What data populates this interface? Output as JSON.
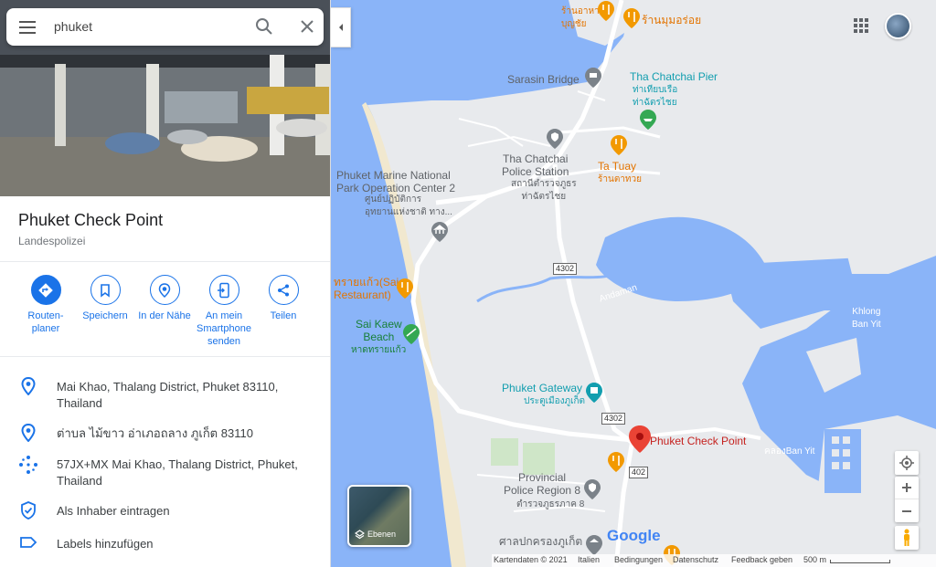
{
  "search": {
    "value": "phuket"
  },
  "place": {
    "title": "Phuket Check Point",
    "category": "Landespolizei"
  },
  "actions": [
    {
      "label": "Routen-\nplaner",
      "icon": "directions-icon"
    },
    {
      "label": "Speichern",
      "icon": "bookmark-icon"
    },
    {
      "label": "In der Nähe",
      "icon": "nearby-icon"
    },
    {
      "label": "An mein Smartphone senden",
      "icon": "send-to-phone-icon"
    },
    {
      "label": "Teilen",
      "icon": "share-icon"
    }
  ],
  "details": {
    "address": "Mai Khao, Thalang District, Phuket 83110, Thailand",
    "address_thai": "ต่าบล ไม้ขาว อ่าเภอถลาง ภูเก็ต 83110",
    "plus_code": "57JX+MX Mai Khao, Thalang District, Phuket, Thailand",
    "claim": "Als Inhaber eintragen",
    "labels": "Labels hinzufügen"
  },
  "map_labels": {
    "sarasin": "Sarasin Bridge",
    "pier": "Tha Chatchai Pier",
    "pier_thai": "ท่าเทียบเรือ\nท่าฉัตรไชย",
    "police_station": "Tha Chatchai\nPolice Station",
    "police_station_thai": "สถานีตำรวจภูธร\nท่าฉัตรไชย",
    "ta_tuay": "Ta Tuay",
    "ta_tuay_thai": "ร้านตาทวย",
    "marine": "Phuket Marine National\nPark Operation Center 2",
    "marine_thai": "ศูนย์ปฏิบัติการ\nอุทยานแห่งชาติ ทาง...",
    "sai_rest": "ทรายแก้ว(Sai\nRestaurant)",
    "sai_kaew": "Sai Kaew\nBeach",
    "sai_kaew_thai": "หาดทรายแก้ว",
    "andaman": "Andaman",
    "khlong": "Khlong\nBan Yit",
    "gateway": "Phuket Gateway",
    "gateway_thai": "ประตูเมืองภูเก็ต",
    "checkpoint": "Phuket Check Point",
    "ban_yit": "คลองBan Yit",
    "provincial": "Provincial\nPolice Region 8",
    "provincial_thai": "ตำรวจภูธรภาค 8",
    "court": "ศาลปกครองภูเก็ต",
    "top_thai1": "ร้านอาหาร",
    "top_thai2": "บุญชัย",
    "top_rest": "ร้านมุมอร่อย",
    "road_4302a": "4302",
    "road_4302b": "4302",
    "road_402": "402",
    "google": "Google"
  },
  "layers": {
    "label": "Ebenen"
  },
  "footer": {
    "mapdata": "Kartendaten © 2021",
    "region": "Italien",
    "terms": "Bedingungen",
    "privacy": "Datenschutz",
    "feedback": "Feedback geben",
    "scale": "500 m"
  },
  "colors": {
    "water": "#8ab4f8",
    "land": "#e8eaed",
    "accent": "#1a73e8",
    "pin": "#ea4335",
    "food": "#f29900",
    "park": "#34a853"
  }
}
